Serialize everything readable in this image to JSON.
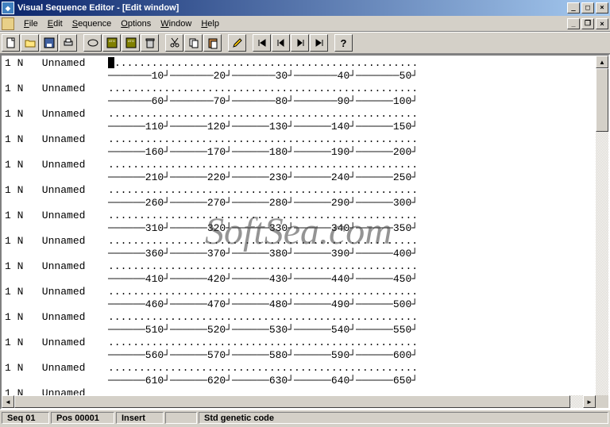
{
  "window": {
    "title": "Visual Sequence Editor - [Edit window]",
    "min": "_",
    "max": "□",
    "close": "×"
  },
  "menus": {
    "file": "File",
    "edit": "Edit",
    "sequence": "Sequence",
    "options": "Options",
    "window": "Window",
    "help": "Help"
  },
  "mdi": {
    "min": "_",
    "restore": "❐",
    "close": "×"
  },
  "toolbar_names": {
    "new": "new",
    "open": "open",
    "save": "save",
    "print": "print",
    "circle": "circle",
    "disk1": "disk1",
    "disk2": "disk2",
    "delete": "delete",
    "cut": "cut",
    "copy": "copy",
    "paste": "paste",
    "pencil": "pencil",
    "first": "first",
    "prev": "prev",
    "next": "next",
    "last": "last",
    "help": "help"
  },
  "content": {
    "row_prefix": "1 N",
    "row_name": "Unnamed",
    "dots": "..................................................",
    "ruler_start": 10,
    "ruler_step": 10,
    "ruler_per_row": 5,
    "row_count": 13
  },
  "status": {
    "seq": "Seq 01",
    "pos": "Pos 00001",
    "mode": "Insert",
    "genetic": "Std genetic code"
  },
  "watermark": "SoftSea.com",
  "icons": {
    "up": "▲",
    "down": "▼",
    "left": "◄",
    "right": "►"
  }
}
